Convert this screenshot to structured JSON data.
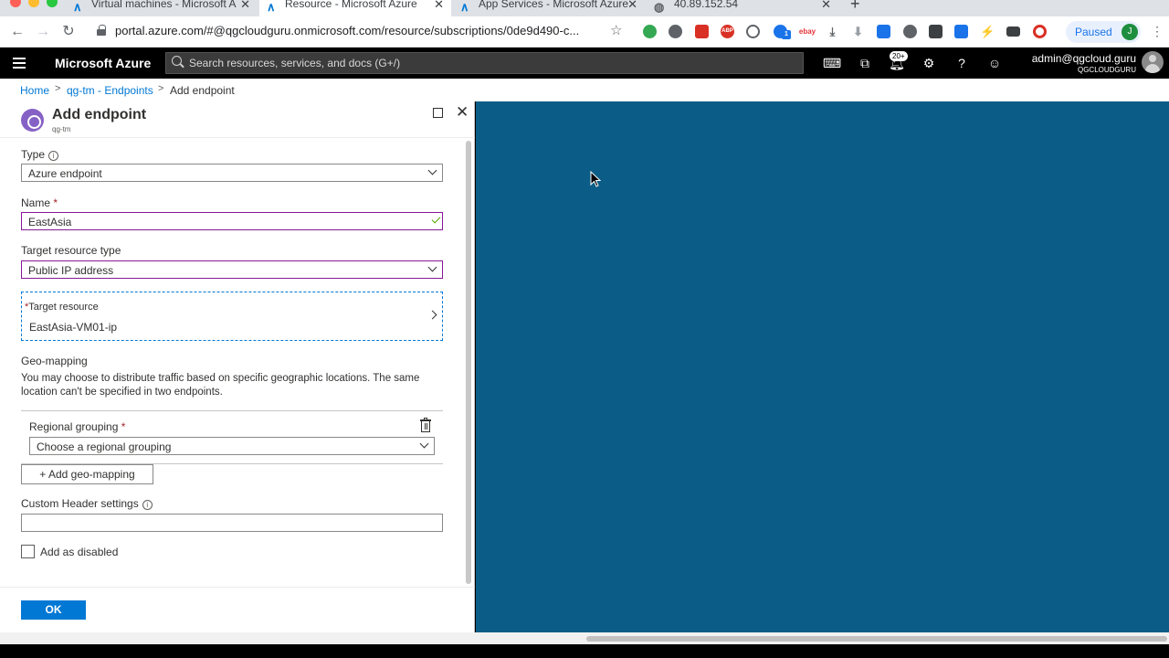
{
  "browser": {
    "tabs": [
      {
        "label": "Virtual machines - Microsoft A",
        "icon": "azure-icon"
      },
      {
        "label": "Resource - Microsoft Azure",
        "icon": "azure-icon"
      },
      {
        "label": "App Services - Microsoft Azure",
        "icon": "azure-icon"
      },
      {
        "label": "40.89.152.54",
        "icon": "globe-icon"
      }
    ],
    "url": "portal.azure.com/#@qgcloudguru.onmicrosoft.com/resource/subscriptions/0de9d490-c...",
    "profile_status": "Paused",
    "profile_initial": "J",
    "extension_labels": {
      "abp": "ABP",
      "ebay": "ebay",
      "badge": "1"
    }
  },
  "azure": {
    "brand": "Microsoft Azure",
    "search_placeholder": "Search resources, services, and docs (G+/)",
    "notification_count": "20+",
    "user_email": "admin@qgcloud.guru",
    "tenant": "QGCLOUDGURU"
  },
  "breadcrumb": {
    "items": [
      "Home",
      "qg-tm - Endpoints",
      "Add endpoint"
    ],
    "separator": ">"
  },
  "blade": {
    "title": "Add endpoint",
    "subtitle": "qg-tm",
    "type": {
      "label": "Type",
      "value": "Azure endpoint"
    },
    "name": {
      "label": "Name",
      "required": "*",
      "value": "EastAsia"
    },
    "target_resource_type": {
      "label": "Target resource type",
      "value": "Public IP address"
    },
    "target_resource": {
      "required": "*",
      "label": "Target resource",
      "value": "EastAsia-VM01-ip"
    },
    "geo_mapping": {
      "title": "Geo-mapping",
      "description": "You may choose to distribute traffic based on specific geographic locations. The same location can't be specified in two endpoints.",
      "regional_grouping_label": "Regional grouping",
      "regional_grouping_required": "*",
      "regional_grouping_placeholder": "Choose a regional grouping",
      "add_button": "+ Add geo-mapping"
    },
    "custom_header": {
      "label": "Custom Header settings",
      "value": ""
    },
    "add_disabled": {
      "label": "Add as disabled",
      "checked": false
    },
    "ok_button": "OK",
    "info_glyph": "i"
  },
  "colors": {
    "accent": "#0078d4",
    "focus_border": "#881798",
    "right_pane": "#0b5d87",
    "top_bar": "#000000"
  }
}
